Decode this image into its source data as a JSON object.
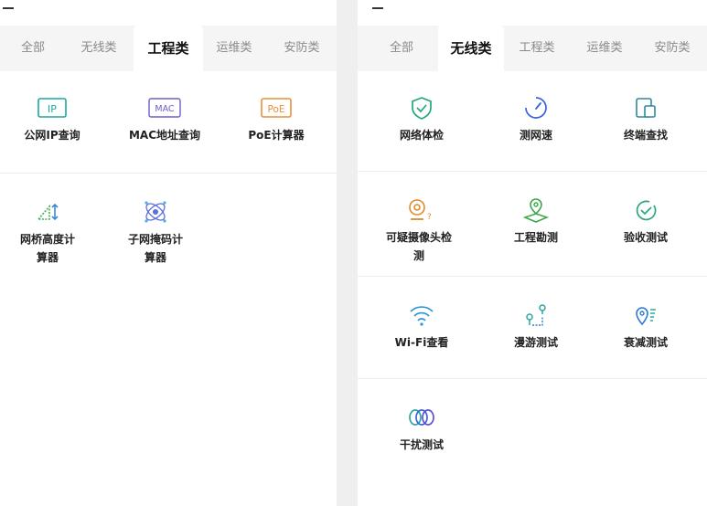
{
  "left": {
    "tabs": [
      "全部",
      "无线类",
      "工程类",
      "运维类",
      "安防类"
    ],
    "active_tab": "工程类",
    "items": [
      {
        "label": "公网IP查询",
        "icon": "ip-icon",
        "icon_text": "IP",
        "color": "#1aa8a0"
      },
      {
        "label": "MAC地址查询",
        "icon": "mac-icon",
        "icon_text": "MAC",
        "color": "#6b5fc7"
      },
      {
        "label": "PoE计算器",
        "icon": "poe-icon",
        "icon_text": "PoE",
        "color": "#e8903a"
      },
      {
        "label": "网桥高度计算器",
        "icon": "bridge-height-icon",
        "color": "#3bb24a"
      },
      {
        "label": "子网掩码计算器",
        "icon": "subnet-mask-icon",
        "color": "#5b6fd6"
      }
    ]
  },
  "right": {
    "tabs": [
      "全部",
      "无线类",
      "工程类",
      "运维类",
      "安防类"
    ],
    "active_tab": "无线类",
    "items": [
      {
        "label": "网络体检",
        "icon": "shield-check-icon",
        "color": "#23a67f"
      },
      {
        "label": "测网速",
        "icon": "speedometer-icon",
        "color": "#3b63d8"
      },
      {
        "label": "终端查找",
        "icon": "device-search-icon",
        "color": "#2b8a9a"
      },
      {
        "label": "可疑摄像头检测",
        "icon": "camera-suspect-icon",
        "color": "#e08a2a"
      },
      {
        "label": "工程勘测",
        "icon": "map-pin-icon",
        "color": "#3aa84a"
      },
      {
        "label": "验收测试",
        "icon": "check-circle-icon",
        "color": "#2aa87a"
      },
      {
        "label": "Wi-Fi查看",
        "icon": "wifi-icon",
        "color": "#2a96d6"
      },
      {
        "label": "漫游测试",
        "icon": "roaming-icon",
        "color": "#2aa8a0"
      },
      {
        "label": "衰减测试",
        "icon": "attenuation-icon",
        "color": "#2a7ad6"
      },
      {
        "label": "干扰测试",
        "icon": "interference-icon",
        "color": "#4a5fd6"
      }
    ]
  }
}
